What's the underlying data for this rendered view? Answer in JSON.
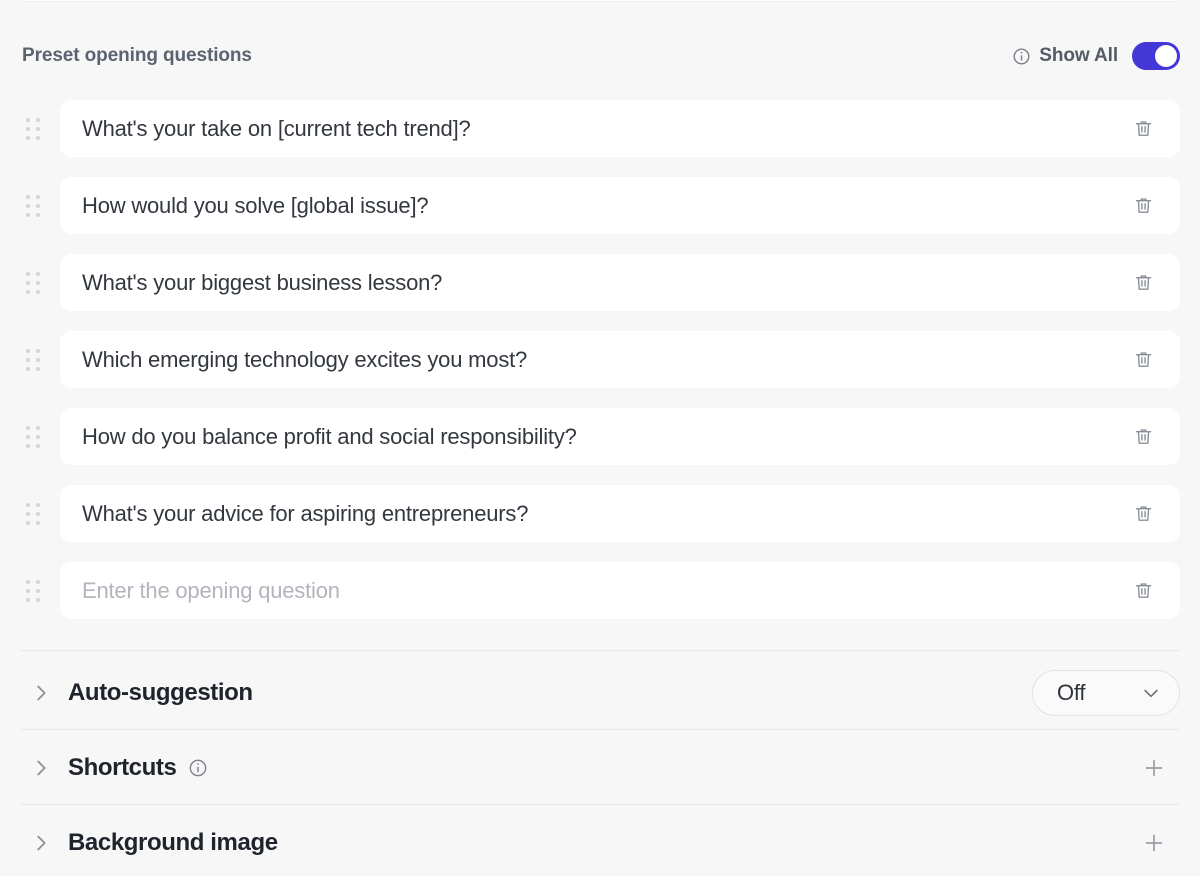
{
  "theme": {
    "page_background": "#f7f7f8",
    "card_background": "#ffffff",
    "accent": "#4338d6",
    "divider": "#e8e8ea",
    "text_primary": "#1f232b",
    "text_secondary": "#5c6370",
    "placeholder": "#b2b5bb"
  },
  "section": {
    "title": "Preset opening questions",
    "show_all_label": "Show All",
    "show_all_enabled": true,
    "info_icon": "info-circle-icon",
    "toggle_icon": "toggle-switch-on-icon"
  },
  "questions": [
    {
      "value": "What's your take on [current tech trend]?",
      "is_placeholder": false
    },
    {
      "value": "How would you solve [global issue]?",
      "is_placeholder": false
    },
    {
      "value": "What's your biggest business lesson?",
      "is_placeholder": false
    },
    {
      "value": "Which emerging technology excites you most?",
      "is_placeholder": false
    },
    {
      "value": "How do you balance profit and social responsibility?",
      "is_placeholder": false
    },
    {
      "value": "What's your advice for aspiring entrepreneurs?",
      "is_placeholder": false
    },
    {
      "value": "Enter the opening question",
      "is_placeholder": true
    }
  ],
  "row_icons": {
    "drag_handle": "drag-handle-icon",
    "delete": "trash-icon"
  },
  "collapsible_sections": [
    {
      "label": "Auto-suggestion",
      "chevron": "chevron-right-icon",
      "has_info": false,
      "control": "select",
      "select_value": "Off",
      "select_chevron": "chevron-down-icon"
    },
    {
      "label": "Shortcuts",
      "chevron": "chevron-right-icon",
      "has_info": true,
      "info_icon": "info-circle-icon",
      "control": "add",
      "add_icon": "plus-icon"
    },
    {
      "label": "Background image",
      "chevron": "chevron-right-icon",
      "has_info": false,
      "control": "add",
      "add_icon": "plus-icon"
    }
  ]
}
